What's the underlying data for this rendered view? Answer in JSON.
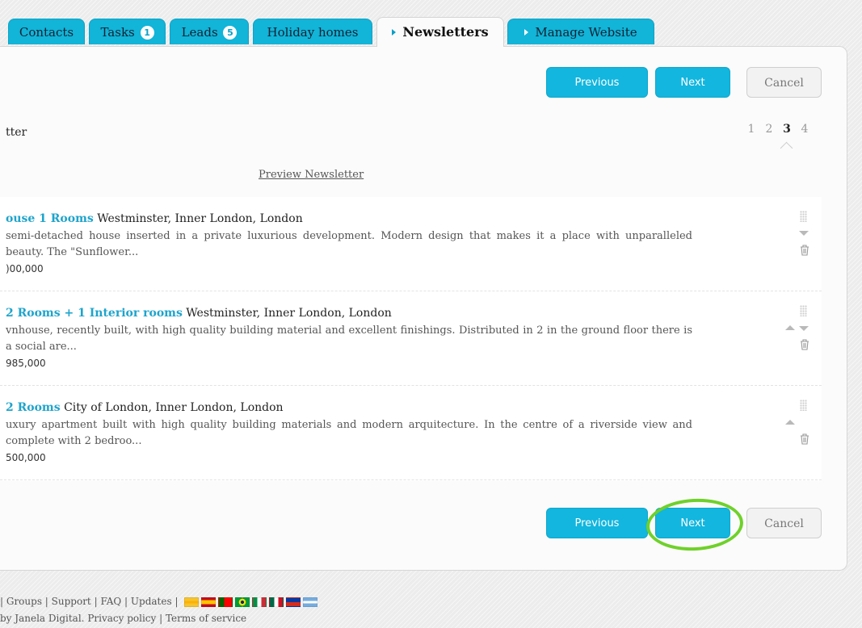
{
  "tabs": [
    {
      "label": "Contacts",
      "badge": null
    },
    {
      "label": "Tasks",
      "badge": "1"
    },
    {
      "label": "Leads",
      "badge": "5"
    },
    {
      "label": "Holiday homes",
      "badge": null
    },
    {
      "label": "Newsletters",
      "badge": null,
      "active": true
    },
    {
      "label": "Manage Website",
      "badge": null
    }
  ],
  "wizard": {
    "previous_label": "Previous",
    "next_label": "Next",
    "cancel_label": "Cancel",
    "step_title": "tter",
    "steps": [
      "1",
      "2",
      "3",
      "4"
    ],
    "current_step": "3",
    "preview_link": "Preview Newsletter"
  },
  "items": [
    {
      "title_link": "ouse 1 Rooms",
      "location": " Westminster, Inner London, London",
      "description": "semi-detached house inserted in a private luxurious development. Modern design that makes it a place with unparalleled beauty. The \"Sunflower...",
      "price": ")00,000"
    },
    {
      "title_link": "2 Rooms + 1 Interior rooms",
      "location": " Westminster, Inner London, London",
      "description": "vnhouse, recently built, with high quality building material and excellent finishings. Distributed in 2 in the ground floor there is a social are...",
      "price": "985,000"
    },
    {
      "title_link": "2 Rooms",
      "location": " City of London, Inner London, London",
      "description": "uxury apartment built with high quality building materials and modern arquitecture. In the centre of a riverside view and complete with 2 bedroo...",
      "price": "500,000"
    }
  ],
  "footer": {
    "line1": [
      "Groups",
      "Support",
      "FAQ",
      "Updates"
    ],
    "line2_prefix": "by Janela Digital.",
    "privacy": "Privacy policy",
    "terms": "Terms of service"
  },
  "colors": {
    "accent": "#12b6de",
    "highlight_circle": "#6fd12a",
    "link": "#1ea4cc"
  }
}
